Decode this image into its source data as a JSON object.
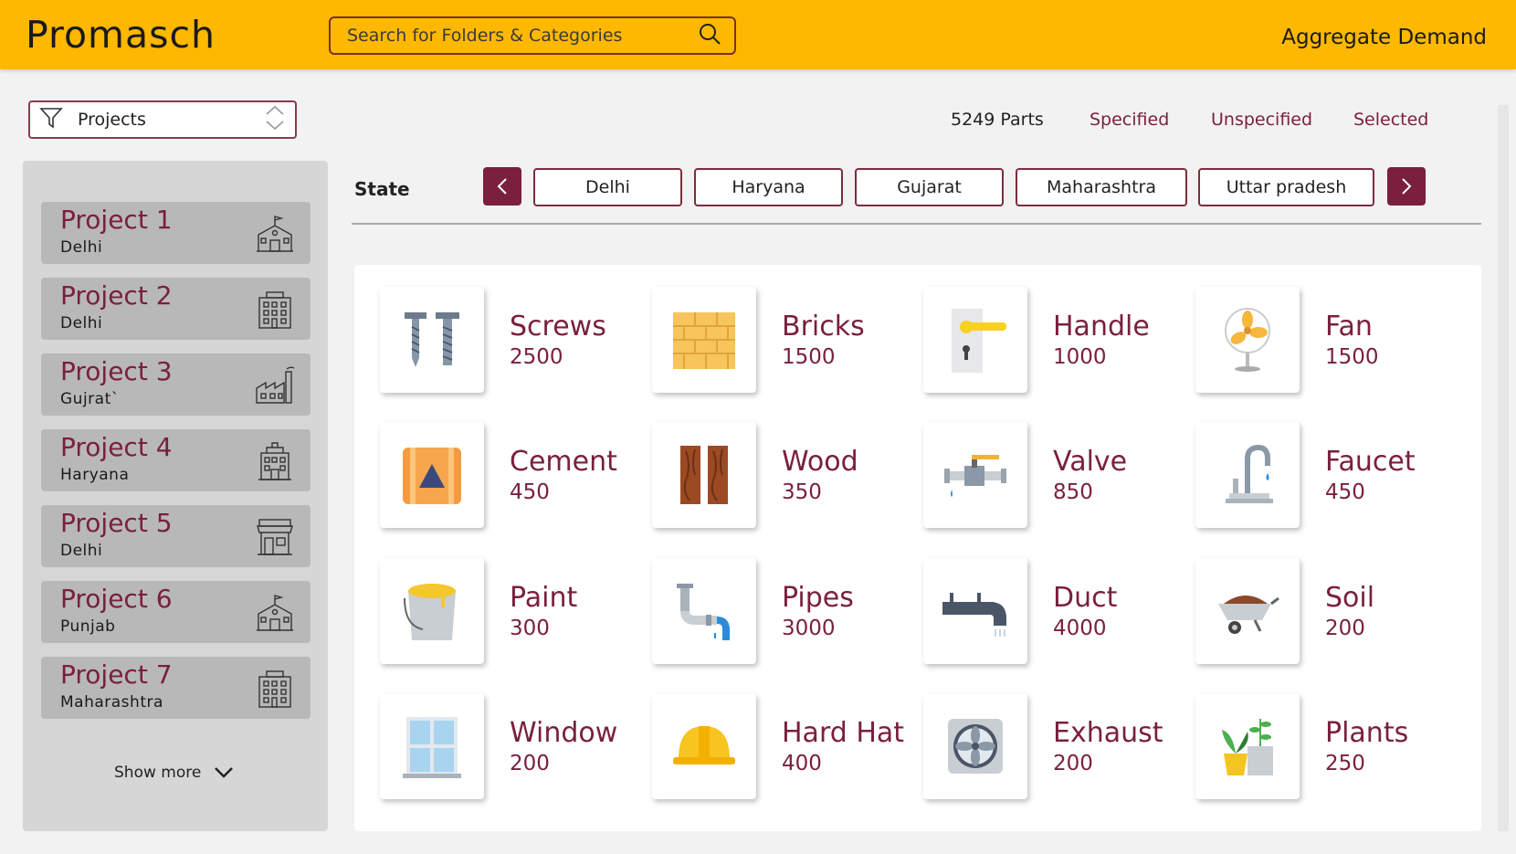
{
  "header": {
    "logo": "Promasch",
    "search_placeholder": "Search for Folders & Categories",
    "aggregate_label": "Aggregate Demand"
  },
  "filter": {
    "label": "Projects"
  },
  "stats": {
    "parts": "5249 Parts",
    "specified": "Specified",
    "unspecified": "Unspecified",
    "selected": "Selected"
  },
  "sidebar": {
    "projects": [
      {
        "name": "Project 1",
        "state": "Delhi",
        "icon": "school-icon"
      },
      {
        "name": "Project 2",
        "state": "Delhi",
        "icon": "building-icon"
      },
      {
        "name": "Project 3",
        "state": "Gujrat`",
        "icon": "factory-icon"
      },
      {
        "name": "Project 4",
        "state": "Haryana",
        "icon": "office-icon"
      },
      {
        "name": "Project 5",
        "state": "Delhi",
        "icon": "store-icon"
      },
      {
        "name": "Project 6",
        "state": "Punjab",
        "icon": "school-icon"
      },
      {
        "name": "Project 7",
        "state": "Maharashtra",
        "icon": "building-icon"
      }
    ],
    "show_more": "Show more"
  },
  "state_bar": {
    "label": "State",
    "states": [
      "Delhi",
      "Haryana",
      "Gujarat",
      "Maharashtra",
      "Uttar pradesh"
    ]
  },
  "categories": [
    {
      "name": "Screws",
      "qty": "2500",
      "icon": "screws-icon"
    },
    {
      "name": "Bricks",
      "qty": "1500",
      "icon": "bricks-icon"
    },
    {
      "name": "Handle",
      "qty": "1000",
      "icon": "door-handle-icon"
    },
    {
      "name": "Fan",
      "qty": "1500",
      "icon": "fan-icon"
    },
    {
      "name": "Cement",
      "qty": "450",
      "icon": "cement-bag-icon"
    },
    {
      "name": "Wood",
      "qty": "350",
      "icon": "wood-planks-icon"
    },
    {
      "name": "Valve",
      "qty": "850",
      "icon": "valve-icon"
    },
    {
      "name": "Faucet",
      "qty": "450",
      "icon": "faucet-icon"
    },
    {
      "name": "Paint",
      "qty": "300",
      "icon": "paint-bucket-icon"
    },
    {
      "name": "Pipes",
      "qty": "3000",
      "icon": "pipes-icon"
    },
    {
      "name": "Duct",
      "qty": "4000",
      "icon": "duct-icon"
    },
    {
      "name": "Soil",
      "qty": "200",
      "icon": "wheelbarrow-icon"
    },
    {
      "name": "Window",
      "qty": "200",
      "icon": "window-icon"
    },
    {
      "name": "Hard Hat",
      "qty": "400",
      "icon": "hard-hat-icon"
    },
    {
      "name": "Exhaust",
      "qty": "200",
      "icon": "exhaust-fan-icon"
    },
    {
      "name": "Plants",
      "qty": "250",
      "icon": "plants-icon"
    }
  ],
  "colors": {
    "header": "#ffb800",
    "accent": "#7a1f3e",
    "sidebar": "#d6d6d6",
    "project_card": "#b8b8b8"
  }
}
